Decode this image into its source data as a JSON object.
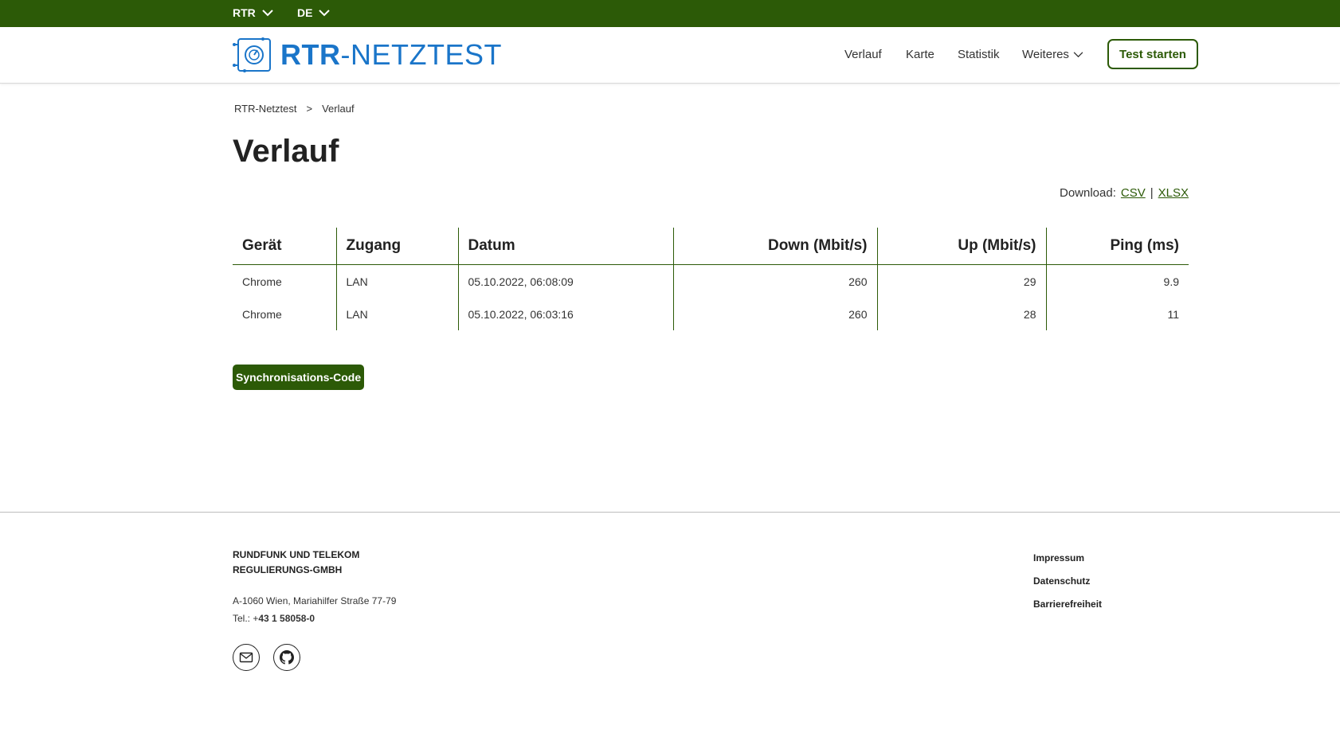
{
  "topbar": {
    "org_selector": "RTR",
    "lang_selector": "DE"
  },
  "header": {
    "logo_text_bold": "RTR",
    "logo_text_rest": "-NETZTEST",
    "nav": {
      "verlauf": "Verlauf",
      "karte": "Karte",
      "statistik": "Statistik",
      "weiteres": "Weiteres"
    },
    "start_button": "Test starten"
  },
  "breadcrumb": {
    "root": "RTR-Netztest",
    "separator": ">",
    "current": "Verlauf"
  },
  "page": {
    "title": "Verlauf"
  },
  "download": {
    "label": "Download:",
    "csv": "CSV",
    "sep": "|",
    "xlsx": "XLSX"
  },
  "table": {
    "headers": [
      "Gerät",
      "Zugang",
      "Datum",
      "Down (Mbit/s)",
      "Up (Mbit/s)",
      "Ping (ms)"
    ],
    "rows": [
      [
        "Chrome",
        "LAN",
        "05.10.2022, 06:08:09",
        "260",
        "29",
        "9.9"
      ],
      [
        "Chrome",
        "LAN",
        "05.10.2022, 06:03:16",
        "260",
        "28",
        "11"
      ]
    ]
  },
  "sync_button": "Synchronisations-Code",
  "footer": {
    "org_line1": "RUNDFUNK UND TELEKOM",
    "org_line2": "REGULIERUNGS-GMBH",
    "address": "A-1060 Wien, Mariahilfer Straße 77-79",
    "tel_label": "Tel.: +",
    "tel_number": "43 1 58058-0",
    "links": {
      "impressum": "Impressum",
      "datenschutz": "Datenschutz",
      "barrierefreiheit": "Barrierefreiheit"
    }
  },
  "colors": {
    "brand_green": "#2c5a07",
    "logo_blue": "#1a75c9"
  }
}
